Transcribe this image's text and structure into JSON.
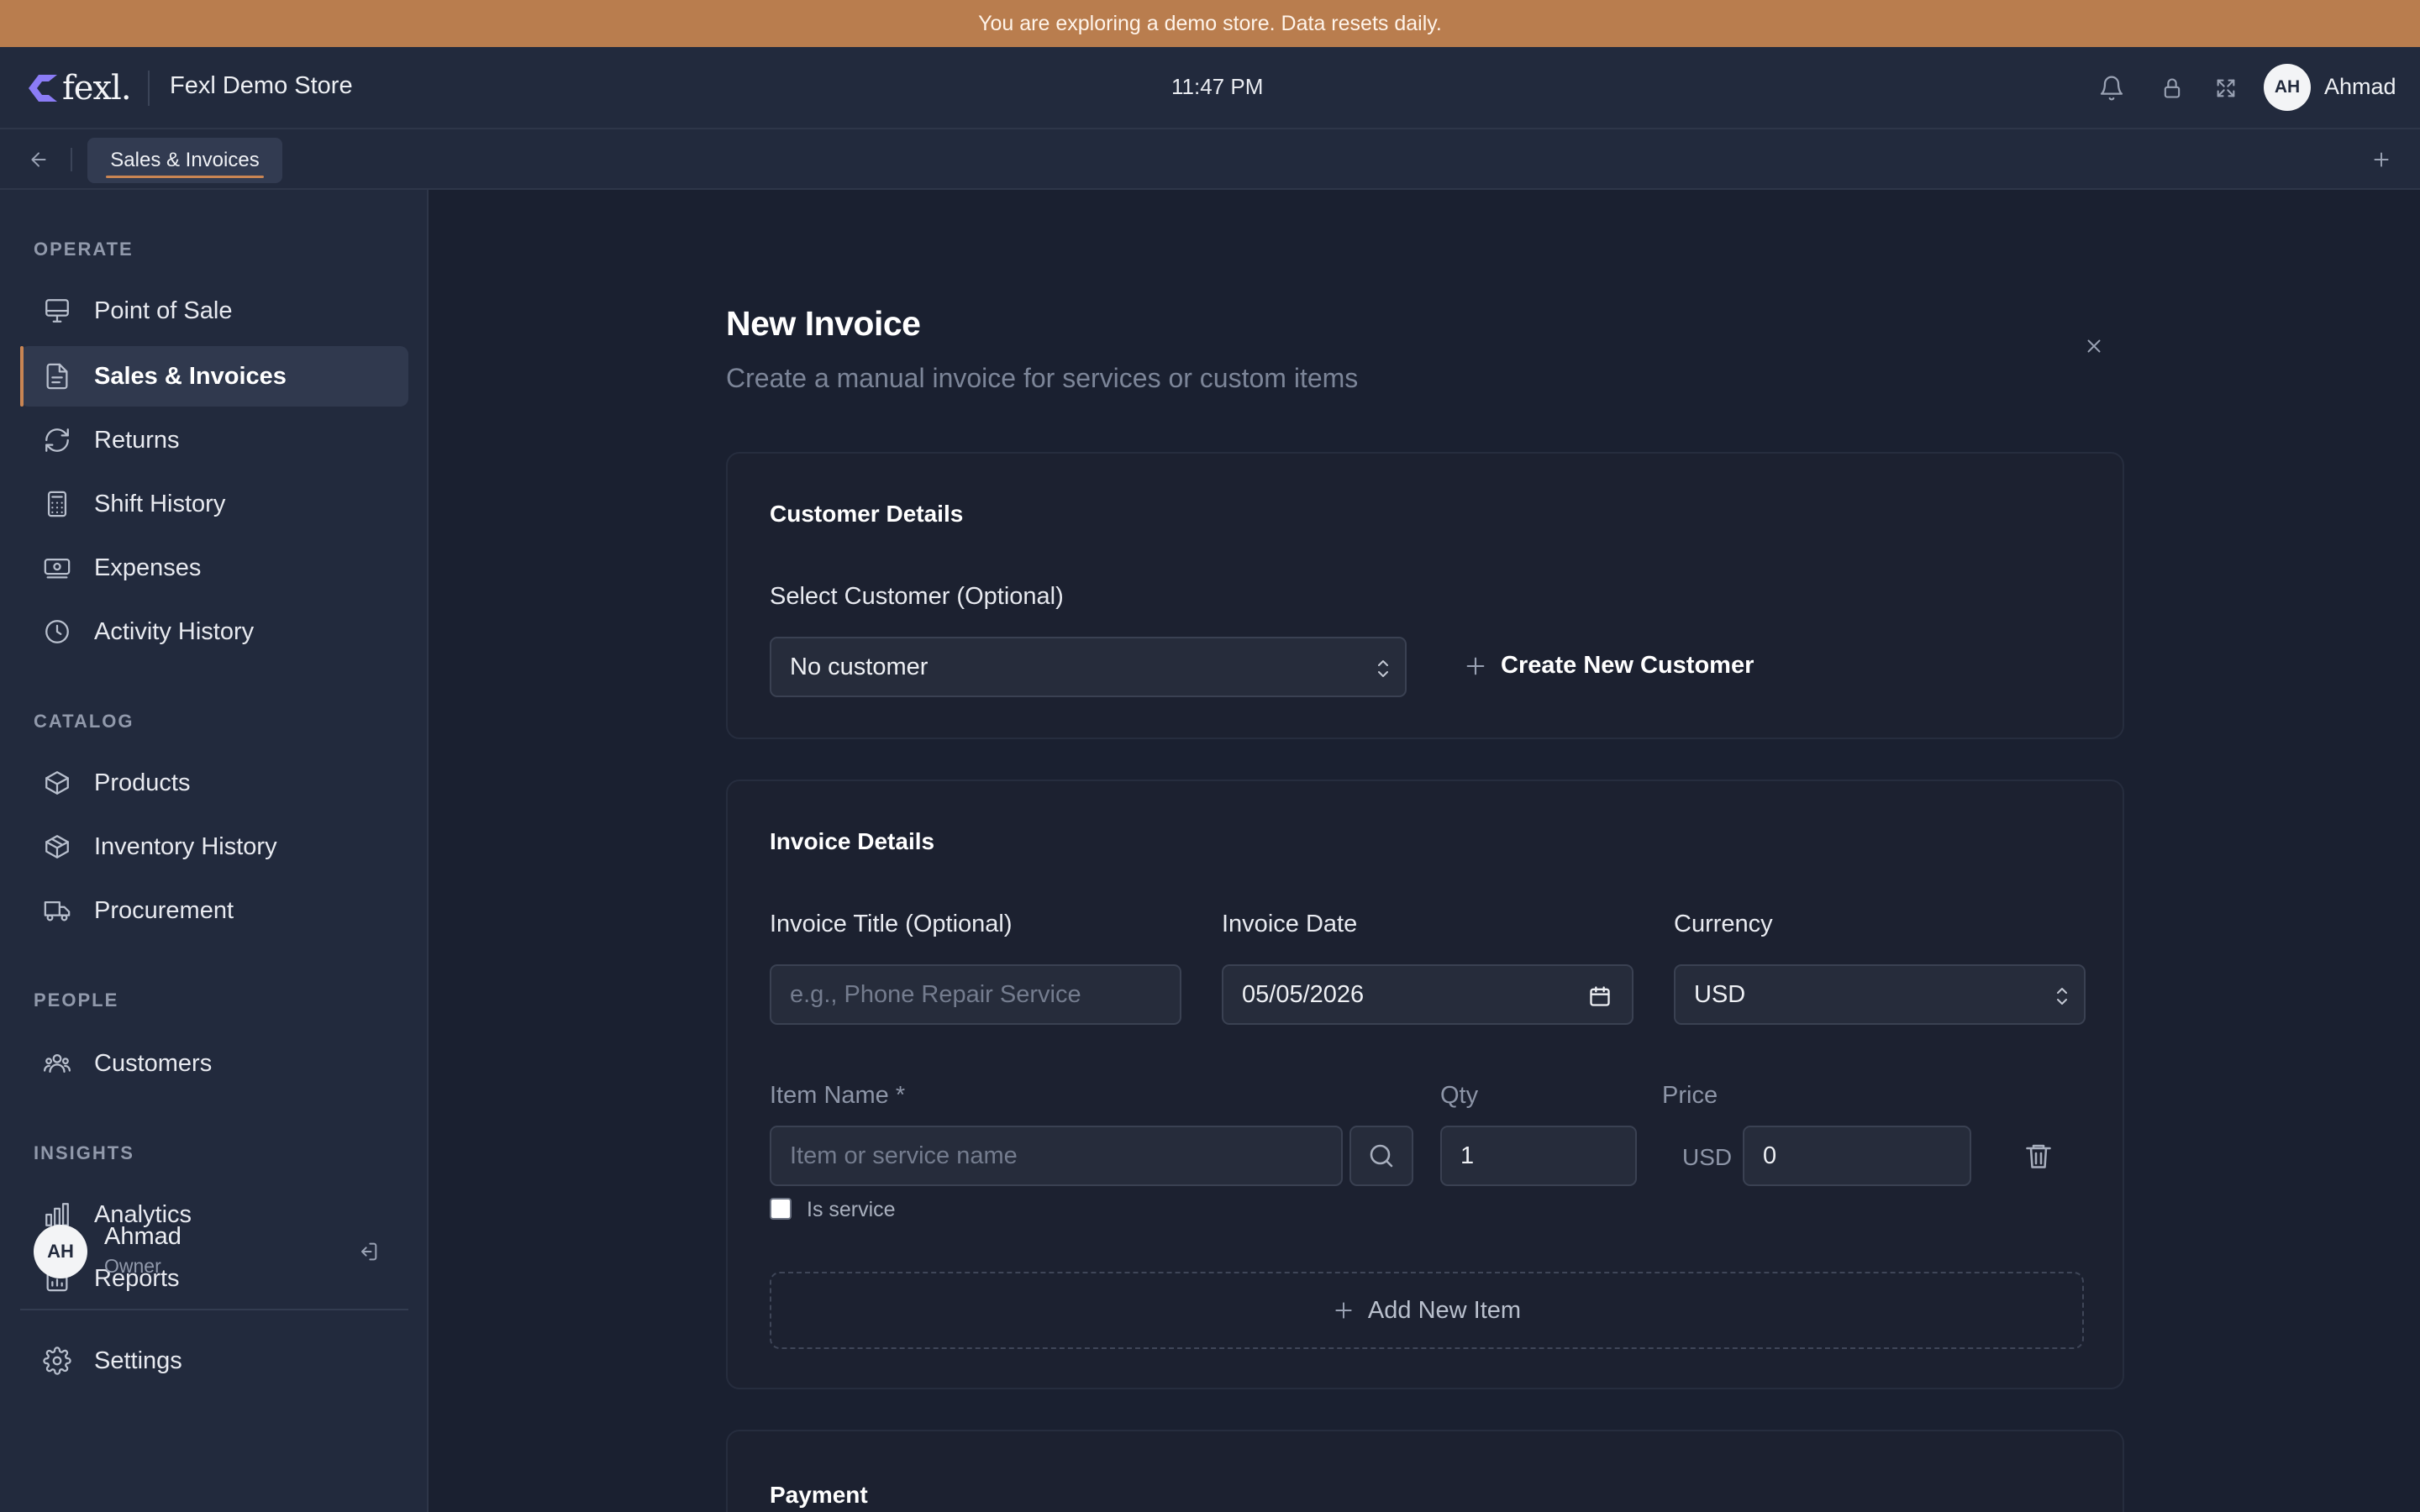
{
  "banner": {
    "text": "You are exploring a demo store. Data resets daily."
  },
  "header": {
    "logo_text": "fexl.",
    "store_name": "Fexl Demo Store",
    "clock": "11:47 PM",
    "user_initials": "AH",
    "user_name": "Ahmad",
    "icons": [
      "bell-icon",
      "lock-icon",
      "fullscreen-icon"
    ]
  },
  "tabbar": {
    "active_tab": "Sales & Invoices"
  },
  "sidebar": {
    "sections": {
      "operate": "OPERATE",
      "catalog": "CATALOG",
      "people": "PEOPLE",
      "insights": "INSIGHTS"
    },
    "items": {
      "point_of_sale": "Point of Sale",
      "sales_invoices": "Sales & Invoices",
      "returns": "Returns",
      "shift_history": "Shift History",
      "expenses": "Expenses",
      "activity_history": "Activity History",
      "products": "Products",
      "inventory_history": "Inventory History",
      "procurement": "Procurement",
      "customers": "Customers",
      "analytics": "Analytics",
      "reports": "Reports",
      "settings": "Settings"
    },
    "active_item": "Sales & Invoices",
    "user": {
      "initials": "AH",
      "name": "Ahmad",
      "role": "Owner"
    }
  },
  "main": {
    "title": "New Invoice",
    "subtitle": "Create a manual invoice for services or custom items",
    "customer_card": {
      "title": "Customer Details",
      "select_label": "Select Customer (Optional)",
      "select_value": "No customer",
      "create_button": "Create New Customer"
    },
    "invoice_card": {
      "title": "Invoice Details",
      "title_label": "Invoice Title (Optional)",
      "title_placeholder": "e.g., Phone Repair Service",
      "date_label": "Invoice Date",
      "date_value": "05/05/2026",
      "currency_label": "Currency",
      "currency_value": "USD",
      "item_name_label": "Item Name *",
      "item_name_placeholder": "Item or service name",
      "qty_label": "Qty",
      "qty_value": "1",
      "price_label": "Price",
      "price_prefix": "USD",
      "price_value": "0",
      "is_service_label": "Is service",
      "is_service_checked": false,
      "add_item_button": "Add New Item"
    },
    "payment_card": {
      "title": "Payment"
    }
  },
  "colors": {
    "banner": "#b97d4e",
    "accent": "#c98553",
    "background": "#1a2030",
    "surface": "#222a3d",
    "card": "#1c2130"
  }
}
